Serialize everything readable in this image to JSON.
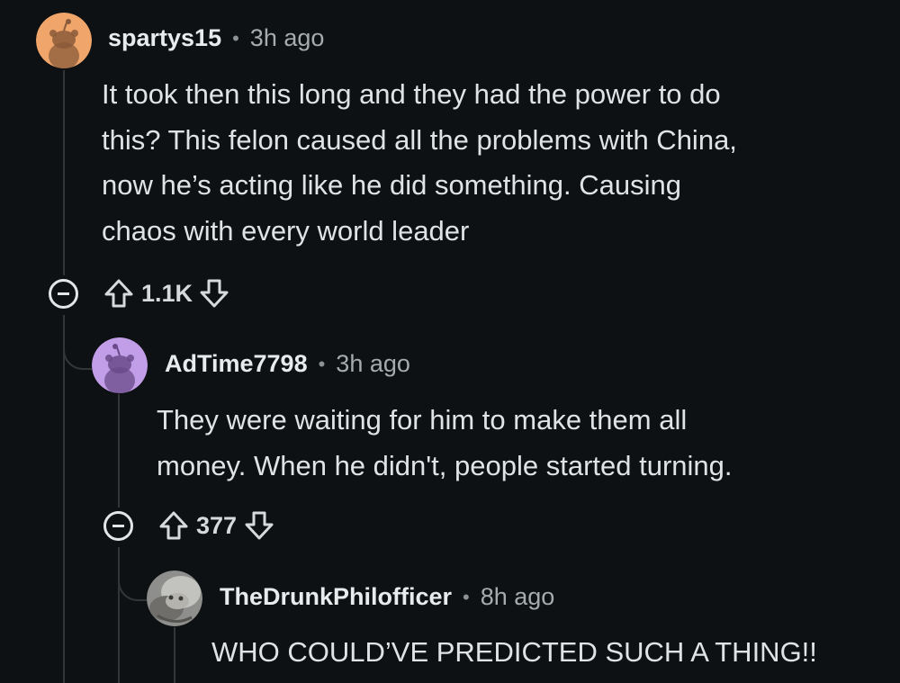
{
  "comments": [
    {
      "username": "spartys15",
      "separator": "•",
      "time": "3h ago",
      "lines": [
        "It took then this long and they had the power to do",
        "this? This felon caused all the problems with China,",
        "now he’s acting like he did something. Causing",
        "chaos with every world leader"
      ],
      "score": "1.1K",
      "avatar_color": "#f0a66a"
    },
    {
      "username": "AdTime7798",
      "separator": "•",
      "time": "3h ago",
      "lines": [
        "They were waiting for him to make them all",
        "money. When he didn't, people started turning."
      ],
      "score": "377",
      "avatar_color": "#c39ee8"
    },
    {
      "username": "TheDrunkPhilofficer",
      "separator": "•",
      "time": "8h ago",
      "lines": [
        "WHO COULD’VE PREDICTED SUCH A THING!!"
      ],
      "avatar_color": "#9a9a98"
    }
  ],
  "icons": {
    "collapse": "collapse-icon",
    "upvote": "upvote-arrow-icon",
    "downvote": "downvote-arrow-icon"
  },
  "colors": {
    "background": "#0e1113",
    "thread_line": "#343536",
    "text": "#d7dadc"
  }
}
